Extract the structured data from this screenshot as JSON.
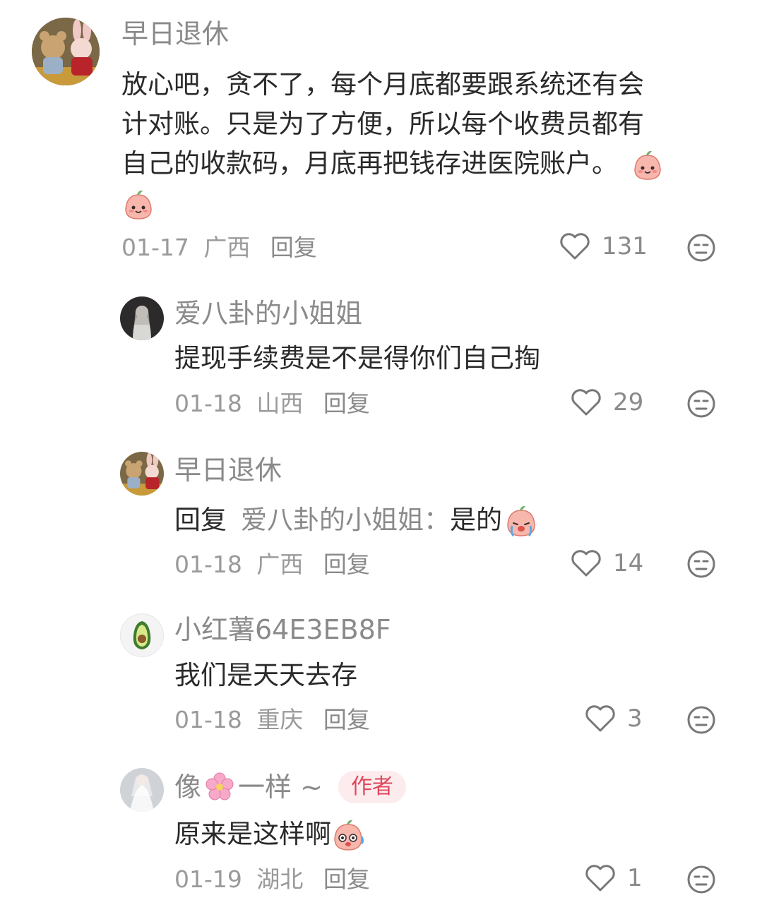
{
  "comments": [
    {
      "user": "早日退休",
      "text_parts": [
        "放心吧，贪不了，每个月底都要跟系统还有会",
        "计对账。只是为了方便，所以每个收费员都有",
        "自己的收款码，月底再把钱存进医院账户。"
      ],
      "date": "01-17",
      "location": "广西",
      "reply_label": "回复",
      "likes": "131",
      "avatar": "teddy-bunny-avatar",
      "emoji": "peach-bun-emoji"
    },
    {
      "user": "爱八卦的小姐姐",
      "text": "提现手续费是不是得你们自己掏",
      "date": "01-18",
      "location": "山西",
      "reply_label": "回复",
      "likes": "29",
      "avatar": "portrait-avatar"
    },
    {
      "user": "早日退休",
      "reply_prefix": "回复",
      "reply_target": "爱八卦的小姐姐：",
      "text": "是的",
      "date": "01-18",
      "location": "广西",
      "reply_label": "回复",
      "likes": "14",
      "avatar": "teddy-bunny-avatar",
      "emoji": "crying-bun-emoji"
    },
    {
      "user": "小红薯64E3EB8F",
      "text": "我们是天天去存",
      "date": "01-18",
      "location": "重庆",
      "reply_label": "回复",
      "likes": "3",
      "avatar": "avocado-avatar"
    },
    {
      "user_a": "像",
      "user_b": "一样 ~",
      "badge": "作者",
      "text": "原来是这样啊",
      "date": "01-19",
      "location": "湖北",
      "reply_label": "回复",
      "likes": "1",
      "avatar": "bride-avatar",
      "emoji": "sweat-bun-emoji",
      "name_emoji": "cherry-blossom-icon"
    }
  ],
  "colors": {
    "badge_bg": "#fdecee",
    "badge_text": "#e0475c",
    "meta": "#9a9a9a"
  }
}
